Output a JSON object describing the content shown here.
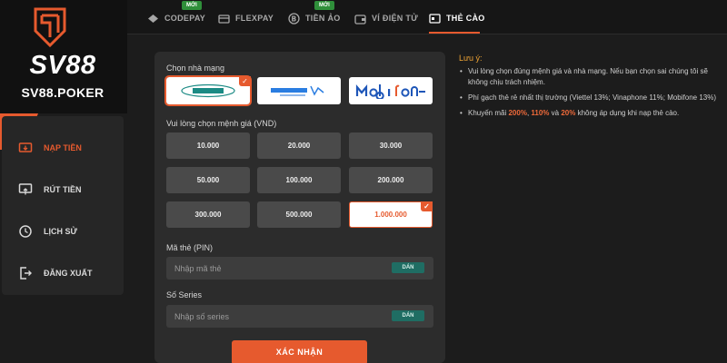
{
  "brand": {
    "name": "SV88",
    "domain": "SV88.POKER",
    "accent": "#e65a2e"
  },
  "tabs": [
    {
      "label": "CODEPAY",
      "badge": "MỚI",
      "icon": "codepay-icon"
    },
    {
      "label": "FLEXPAY",
      "badge": "",
      "icon": "card-icon"
    },
    {
      "label": "TIỀN ẢO",
      "badge": "MỚI",
      "icon": "bitcoin-icon"
    },
    {
      "label": "VÍ ĐIỆN TỬ",
      "badge": "",
      "icon": "wallet-icon"
    },
    {
      "label": "THẺ CÀO",
      "badge": "",
      "icon": "scratch-card-icon",
      "active": true
    }
  ],
  "sidebar": {
    "items": [
      {
        "label": "NẠP TIỀN",
        "icon": "deposit-icon",
        "active": true
      },
      {
        "label": "RÚT TIỀN",
        "icon": "withdraw-icon"
      },
      {
        "label": "LỊCH SỬ",
        "icon": "history-icon"
      },
      {
        "label": "ĐĂNG XUẤT",
        "icon": "logout-icon"
      }
    ]
  },
  "form": {
    "network_label": "Chọn nhà mạng",
    "networks": [
      {
        "name": "viettel",
        "selected": true
      },
      {
        "name": "vinaphone",
        "selected": false
      },
      {
        "name": "mobifone",
        "selected": false
      }
    ],
    "amount_label": "Vui lòng chọn mệnh giá (VND)",
    "amounts": [
      "10.000",
      "20.000",
      "30.000",
      "50.000",
      "100.000",
      "200.000",
      "300.000",
      "500.000",
      "1.000.000"
    ],
    "selected_amount": "1.000.000",
    "pin_label": "Mã thẻ (PIN)",
    "pin_placeholder": "Nhập mã thẻ",
    "serial_label": "Số Series",
    "serial_placeholder": "Nhập số series",
    "paste_label": "DÁN",
    "submit_label": "XÁC NHẬN"
  },
  "notes": {
    "title": "Lưu ý:",
    "item1": "Vui lòng chọn đúng mệnh giá và nhà mạng. Nếu bạn chọn sai chúng tôi sẽ không chịu trách nhiệm.",
    "item2": "Phí gạch thẻ rẻ nhất thị trường (Viettel 13%; Vinaphone 11%; Mobifone 13%)",
    "item3": {
      "prefix": "Khuyến mãi ",
      "p1": "200%",
      "sep1": ", ",
      "p2": "110%",
      "sep2": " và ",
      "p3": "20%",
      "suffix": " không áp dụng khi nạp thẻ cào."
    }
  }
}
